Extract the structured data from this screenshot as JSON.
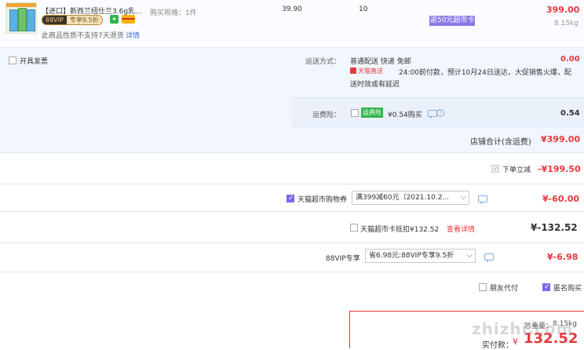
{
  "product": {
    "title": "【进口】新西兰纽仕兰3.6g乳...",
    "vip_badge": "88VIP",
    "vip_discount": "专享9.5折",
    "spec_label": "购买规格：1件",
    "unit_price": "39.90",
    "quantity": "10",
    "promo_tag": "返50元超市卡",
    "subtotal": "399.00",
    "weight": "8.15kg",
    "return_note": "此商品性质不支持7天退货",
    "return_detail": "详情"
  },
  "invoice": {
    "label": "开具发票"
  },
  "shipping": {
    "label": "运送方式：",
    "method": "普通配送 快递 免邮",
    "tmall_tag": "天猫直送",
    "note_line1": "24:00前付款，预计10月24日送达，大促销售火爆，配",
    "note_line2": "送时效或有延迟",
    "fee": "0.00"
  },
  "insurance": {
    "label": "运费险：",
    "tag": "运费险",
    "text": "¥0.54购买",
    "amount": "0.54"
  },
  "store_total": {
    "label": "店铺合计(含运费)",
    "value": "¥399.00"
  },
  "discounts": {
    "instant": {
      "label": "下单立减",
      "value": "-¥199.50"
    },
    "coupon": {
      "label": "天猫超市购物券",
      "selected": "满399减60元（2021.10.2...",
      "value": "¥-60.00"
    },
    "card": {
      "label": "天猫超市卡抵扣¥132.52",
      "link": "查看详情",
      "value": "¥-132.52"
    },
    "vip": {
      "label": "88VIP专享",
      "selected": "省6.98元:88VIP专享9.5折",
      "value": "¥-6.98"
    }
  },
  "options": {
    "friend_pay": "朋友代付",
    "anonymous": "匿名购买"
  },
  "summary": {
    "weight_label": "总重量：",
    "weight": "8.15kg",
    "pay_label": "实付款：",
    "currency": "¥",
    "amount": "132.52"
  },
  "watermark": {
    "site": "zhizhi.com"
  }
}
